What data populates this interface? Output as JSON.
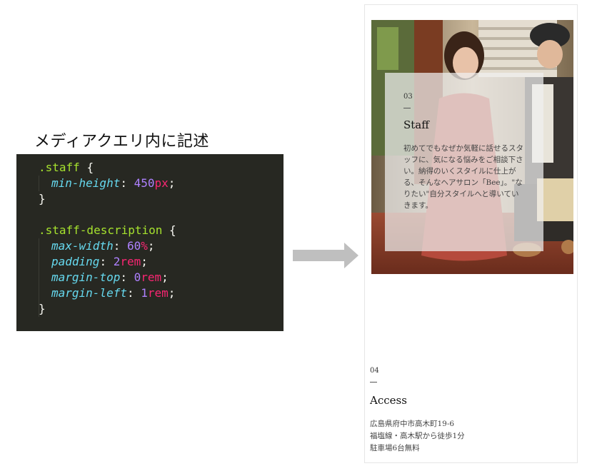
{
  "caption": "メディアクエリ内に記述",
  "code": {
    "staff_selector": ".staff",
    "staff_prop": "min-height",
    "staff_num": "450",
    "staff_unit": "px",
    "desc_selector": ".staff-description",
    "max_width_prop": "max-width",
    "max_width_num": "60",
    "max_width_unit": "%",
    "padding_prop": "padding",
    "padding_num": "2",
    "padding_unit": "rem",
    "margin_top_prop": "margin-top",
    "margin_top_num": "0",
    "margin_top_unit": "rem",
    "margin_left_prop": "margin-left",
    "margin_left_num": "1",
    "margin_left_unit": "rem",
    "open_brace": "{",
    "close_brace": "}"
  },
  "phone": {
    "staff": {
      "number": "03",
      "title": "Staff",
      "description": "初めてでもなぜか気軽に話せるスタッフに、気になる悩みをご相談下さい。納得のいくスタイルに仕上がる、そんなヘアサロン「Bee」。\"なりたい\"自分スタイルへと導いていきます。"
    },
    "access": {
      "number": "04",
      "title": "Access",
      "line1": "広島県府中市高木町19-6",
      "line2": "福塩線・高木駅から徒歩1分",
      "line3": "駐車場6台無料"
    }
  },
  "colors": {
    "code_bg": "#272822",
    "selector": "#a6e22e",
    "property": "#66d9ef",
    "number": "#ae81ff",
    "unit": "#f92672",
    "arrow": "#bfbfbf"
  }
}
